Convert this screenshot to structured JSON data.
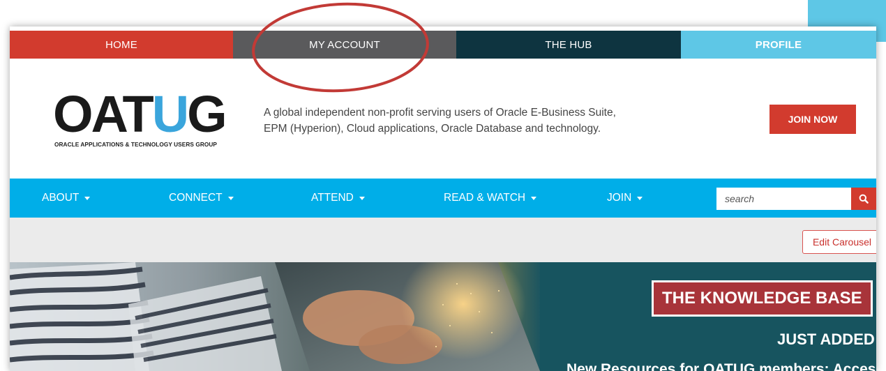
{
  "top_tabs": [
    {
      "label": "HOME",
      "color": "#d23b2e"
    },
    {
      "label": "MY ACCOUNT",
      "color": "#5a5a5c"
    },
    {
      "label": "THE HUB",
      "color": "#0e3440"
    },
    {
      "label": "PROFILE",
      "color": "#5ec7e6"
    }
  ],
  "header": {
    "logo_word_left": "OAT",
    "logo_word_u": "U",
    "logo_word_right": "G",
    "logo_subtitle": "ORACLE APPLICATIONS & TECHNOLOGY USERS GROUP",
    "tagline_line1": "A global independent non-profit serving users of Oracle E-Business Suite,",
    "tagline_line2": "EPM (Hyperion), Cloud applications, Oracle Database and technology.",
    "join_label": "JOIN NOW"
  },
  "nav": {
    "items": [
      {
        "label": "ABOUT"
      },
      {
        "label": "CONNECT"
      },
      {
        "label": "ATTEND"
      },
      {
        "label": "READ & WATCH"
      },
      {
        "label": "JOIN"
      }
    ],
    "search_placeholder": "search"
  },
  "carousel": {
    "edit_label": "Edit Carousel",
    "headline": "THE KNOWLEDGE BASE",
    "subhead": "JUST ADDED",
    "teaser": "New Resources for OATUG members: Access"
  },
  "colors": {
    "brand_red": "#d23b2e",
    "brand_blue": "#00aee8",
    "annotation_red": "#c23a36"
  },
  "icons": {
    "search": "search-icon",
    "caret": "caret-down-icon"
  }
}
